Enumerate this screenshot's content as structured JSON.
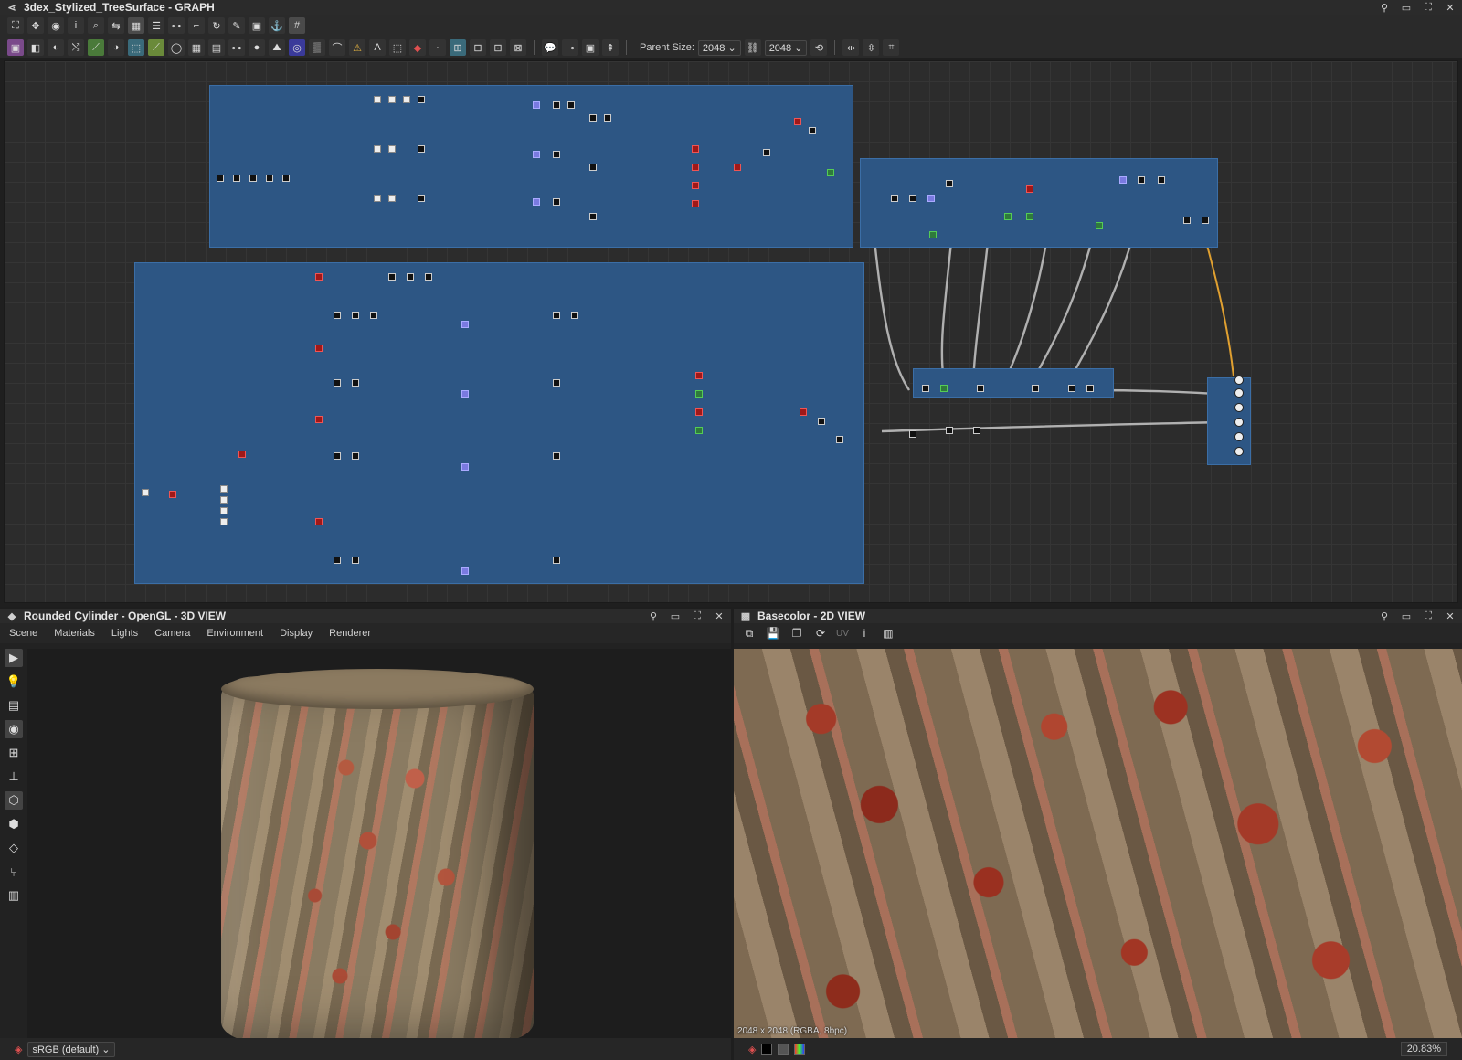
{
  "graph": {
    "title": "3dex_Stylized_TreeSurface - GRAPH",
    "parent_size_label": "Parent Size:",
    "parent_size_value": "2048",
    "output_size_value": "2048"
  },
  "view3d": {
    "title": "Rounded Cylinder - OpenGL - 3D VIEW",
    "menu": [
      "Scene",
      "Materials",
      "Lights",
      "Camera",
      "Environment",
      "Display",
      "Renderer"
    ],
    "colorspace": "sRGB (default)"
  },
  "view2d": {
    "title": "Basecolor - 2D VIEW",
    "uv_label": "UV",
    "resolution": "2048 x 2048 (RGBA, 8bpc)",
    "zoom": "20.83%"
  },
  "icons": {
    "pin": "pin-icon",
    "restore": "restore-icon",
    "maximize": "maximize-icon",
    "close": "close-icon"
  }
}
